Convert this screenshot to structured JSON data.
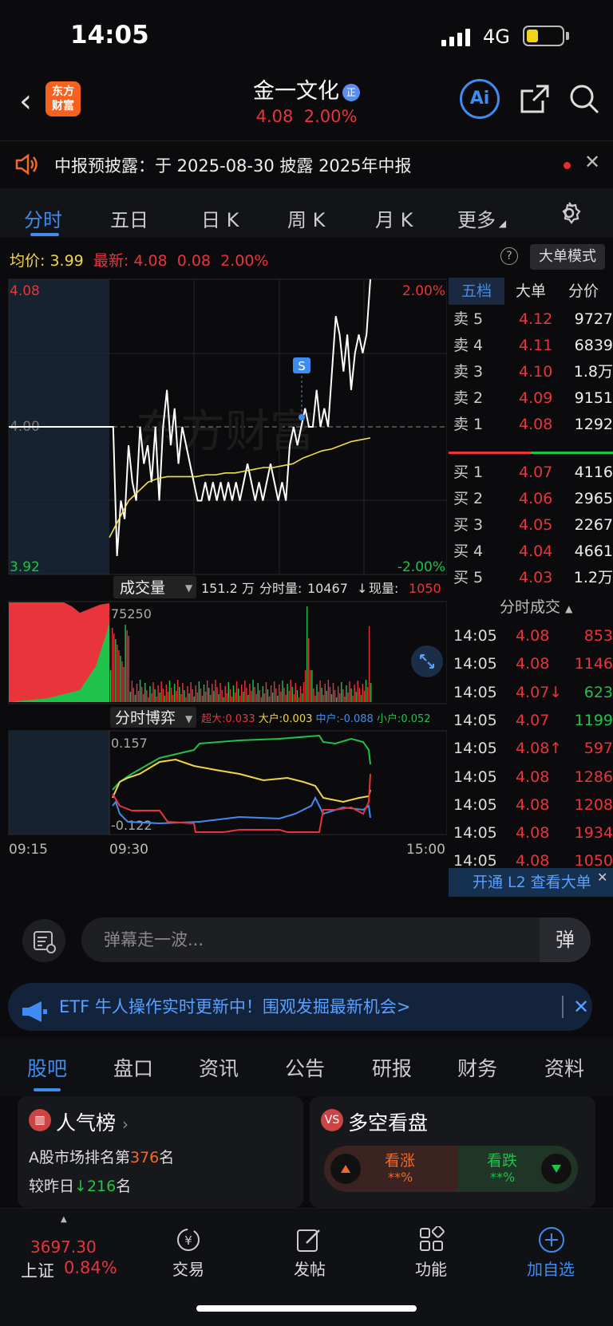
{
  "status": {
    "time": "14:05",
    "network": "4G"
  },
  "header": {
    "logo": "东方财富",
    "stock_name": "金一文化",
    "badge": "正",
    "price": "4.08",
    "change_pct": "2.00%",
    "ai_label": "Ai"
  },
  "notice": {
    "text": "中报预披露：于 2025-08-30 披露 2025年中报"
  },
  "tabs": [
    "分时",
    "五日",
    "日 K",
    "周 K",
    "月 K",
    "更多"
  ],
  "info": {
    "avg_label": "均价:",
    "avg": "3.99",
    "latest_label": "最新:",
    "latest": "4.08",
    "change": "0.08",
    "change_pct": "2.00%",
    "mode": "大单模式"
  },
  "chart_data": {
    "type": "line",
    "title": "",
    "x_start": "09:15",
    "x_open": "09:30",
    "x_end": "15:00",
    "y_top": "4.08",
    "y_bottom": "3.92",
    "pct_top": "2.00%",
    "pct_bottom": "-2.00%",
    "y_mid": "4.00",
    "price_range": [
      3.92,
      4.08
    ],
    "price_series": [
      4.0,
      4.0,
      3.93,
      3.96,
      3.95,
      3.99,
      3.97,
      3.96,
      4.0,
      3.98,
      3.99,
      3.97,
      4.0,
      3.96,
      4.0,
      4.02,
      3.99,
      4.01,
      3.98,
      4.0,
      3.99,
      3.98,
      3.97,
      3.96,
      3.96,
      3.97,
      3.96,
      3.97,
      3.96,
      3.97,
      3.96,
      3.97,
      3.96,
      3.97,
      3.96,
      3.97,
      3.98,
      3.97,
      3.96,
      3.97,
      3.96,
      3.97,
      3.98,
      3.97,
      3.96,
      3.97,
      3.96,
      3.99,
      4.0,
      3.99,
      4.0,
      4.01,
      4.0,
      4.0,
      4.02,
      4.0,
      4.01,
      4.0,
      4.03,
      4.06,
      4.05,
      4.03,
      4.05,
      4.02,
      4.04,
      4.05,
      4.04,
      4.05,
      4.08
    ],
    "avg_series": [
      3.94,
      3.95,
      3.96,
      3.965,
      3.97,
      3.972,
      3.973,
      3.973,
      3.973,
      3.973,
      3.974,
      3.974,
      3.975,
      3.975,
      3.976,
      3.977,
      3.978,
      3.978,
      3.979,
      3.98,
      3.983,
      3.985,
      3.987,
      3.988,
      3.99,
      3.992,
      3.993,
      3.994
    ],
    "signal_label": "S",
    "volume": {
      "label": "成交量",
      "total": "151.2 万",
      "period_label": "分时量:",
      "period": "10467",
      "now_label": "现量:",
      "now": "1050",
      "axis_max": "75250"
    },
    "flow": {
      "label": "分时博弈",
      "super_label": "超大:",
      "super": "0.033",
      "large_label": "大户:",
      "large": "0.003",
      "mid_label": "中户:",
      "mid": "-0.088",
      "small_label": "小户:",
      "small": "0.052",
      "ymax": "0.157",
      "ymin": "-0.122"
    }
  },
  "orderbook": {
    "headers": [
      "五档",
      "大单",
      "分价"
    ],
    "asks": [
      [
        "卖 5",
        "4.12",
        "9727"
      ],
      [
        "卖 4",
        "4.11",
        "6839"
      ],
      [
        "卖 3",
        "4.10",
        "1.8万"
      ],
      [
        "卖 2",
        "4.09",
        "9151"
      ],
      [
        "卖 1",
        "4.08",
        "1292"
      ]
    ],
    "bids": [
      [
        "买 1",
        "4.07",
        "4116"
      ],
      [
        "买 2",
        "4.06",
        "2965"
      ],
      [
        "买 3",
        "4.05",
        "2267"
      ],
      [
        "买 4",
        "4.04",
        "4661"
      ],
      [
        "买 5",
        "4.03",
        "1.2万"
      ]
    ]
  },
  "trades": {
    "title": "分时成交",
    "rows": [
      [
        "14:05",
        "4.08",
        "853",
        "r"
      ],
      [
        "14:05",
        "4.08",
        "1146",
        "r"
      ],
      [
        "14:05",
        "4.07↓",
        "623",
        "g"
      ],
      [
        "14:05",
        "4.07",
        "1199",
        "g"
      ],
      [
        "14:05",
        "4.08↑",
        "597",
        "r"
      ],
      [
        "14:05",
        "4.08",
        "1286",
        "r"
      ],
      [
        "14:05",
        "4.08",
        "1208",
        "r"
      ],
      [
        "14:05",
        "4.08",
        "1934",
        "r"
      ],
      [
        "14:05",
        "4.08",
        "1050",
        "r"
      ]
    ]
  },
  "l2": "开通 L2 查看大单",
  "danmu": {
    "placeholder": "弹幕走一波...",
    "button": "弹"
  },
  "etf_banner": "ETF 牛人操作实时更新中！围观发掘最新机会>",
  "bottom_tabs": [
    "股吧",
    "盘口",
    "资讯",
    "公告",
    "研报",
    "财务",
    "资料"
  ],
  "card_popularity": {
    "title": "人气榜",
    "rank_prefix": "A股市场排名第",
    "rank": "376",
    "rank_suffix": "名",
    "change_prefix": "较昨日",
    "change": "216",
    "change_suffix": "名"
  },
  "card_sentiment": {
    "title": "多空看盘",
    "bull": "看涨",
    "bull_pct": "**%",
    "bear": "看跌",
    "bear_pct": "**%"
  },
  "nav": {
    "index_value": "3697.30",
    "index_name": "上证",
    "index_pct": "0.84%",
    "items": [
      "交易",
      "发帖",
      "功能",
      "加自选"
    ]
  }
}
